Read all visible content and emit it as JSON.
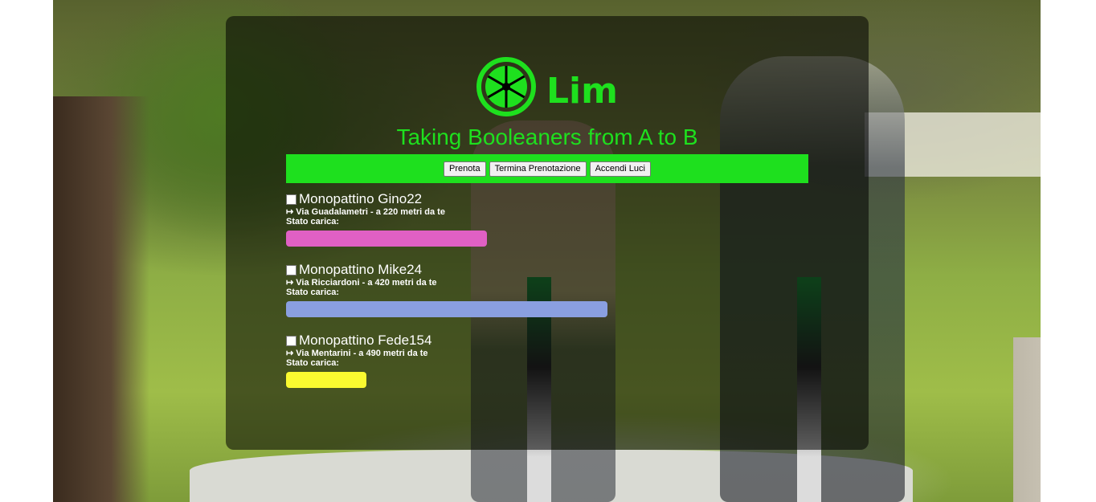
{
  "brand": {
    "logo_text": "Lim",
    "tagline": "Taking Booleaners from A to B",
    "accent_color": "#1ee01e"
  },
  "toolbar": {
    "prenota_label": "Prenota",
    "termina_label": "Termina Prenotazione",
    "accendi_label": "Accendi Luci"
  },
  "scooters": [
    {
      "name": "Monopattino Gino22",
      "location": "↦ Via Guadalametri - a 220 metri da te",
      "stato_label": "Stato carica:",
      "charge_fraction": 0.625,
      "bar_color": "#e060c4",
      "checked": false
    },
    {
      "name": "Monopattino Mike24",
      "location": "↦ Via Ricciardoni - a 420 metri da te",
      "stato_label": "Stato carica:",
      "charge_fraction": 1.0,
      "bar_color": "#8a9fe0",
      "checked": false
    },
    {
      "name": "Monopattino Fede154",
      "location": "↦ Via Mentarini - a 490 metri da te",
      "stato_label": "Stato carica:",
      "charge_fraction": 0.25,
      "bar_color": "#fafa30",
      "checked": false
    }
  ],
  "icons": {
    "logo_icon": "lime-wheel-icon"
  }
}
